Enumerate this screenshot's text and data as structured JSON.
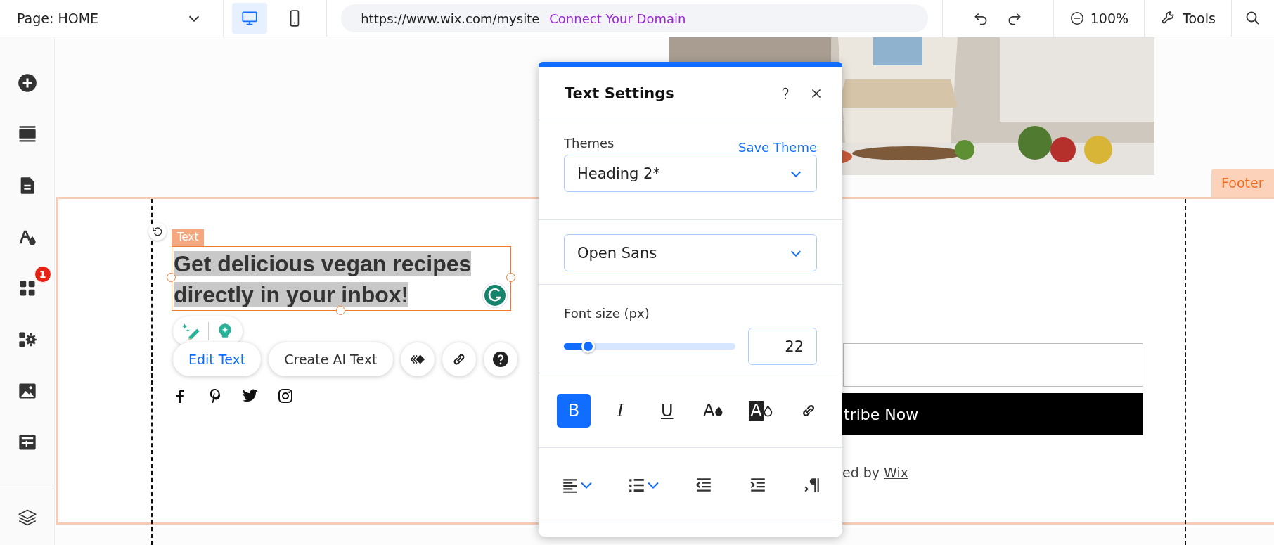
{
  "top_bar": {
    "page_selector": "Page: HOME",
    "devices": [
      {
        "kind": "desktop",
        "selected": true
      },
      {
        "kind": "mobile",
        "selected": false
      }
    ],
    "url": "https://www.wix.com/mysite",
    "connect_link": "Connect Your Domain",
    "zoom": "100%",
    "tools": "Tools"
  },
  "sidebar": {
    "items": [
      {
        "kind": "add"
      },
      {
        "kind": "sections"
      },
      {
        "kind": "pages"
      },
      {
        "kind": "design"
      },
      {
        "kind": "apps",
        "badge": "1"
      },
      {
        "kind": "business"
      },
      {
        "kind": "media"
      },
      {
        "kind": "cms"
      }
    ],
    "bottom": [
      {
        "kind": "layers"
      }
    ]
  },
  "canvas": {
    "section_tag": "Footer",
    "element_tag": "Text",
    "selected_text": "Get delicious vegan recipes directly in your inbox!",
    "actions": [
      {
        "kind": "edit",
        "label": "Edit Text"
      },
      {
        "kind": "ai",
        "label": "Create AI Text"
      },
      {
        "kind": "animation"
      },
      {
        "kind": "link"
      },
      {
        "kind": "help"
      }
    ],
    "social": [
      {
        "kind": "facebook"
      },
      {
        "kind": "pinterest"
      },
      {
        "kind": "twitter"
      },
      {
        "kind": "instagram"
      }
    ],
    "subscribe_button": "tribe Now",
    "credit_text": "ed by",
    "credit_link": "Wix"
  },
  "text_settings": {
    "title": "Text Settings",
    "themes_label": "Themes",
    "save_theme": "Save Theme",
    "theme": "Heading 2*",
    "font": "Open Sans",
    "font_size_label": "Font size (px)",
    "font_size": {
      "level": 0.14,
      "value": "22"
    },
    "format": [
      {
        "kind": "bold",
        "label": "B",
        "selected": true
      },
      {
        "kind": "italic",
        "label": "I",
        "selected": false
      },
      {
        "kind": "underline",
        "label": "U",
        "selected": false
      },
      {
        "kind": "color",
        "label": "A",
        "selected": false
      },
      {
        "kind": "highlight",
        "label": "A",
        "selected": false
      },
      {
        "kind": "link",
        "selected": false
      }
    ],
    "paragraph": [
      {
        "kind": "align"
      },
      {
        "kind": "list"
      },
      {
        "kind": "outdent"
      },
      {
        "kind": "indent"
      },
      {
        "kind": "direction"
      }
    ]
  }
}
